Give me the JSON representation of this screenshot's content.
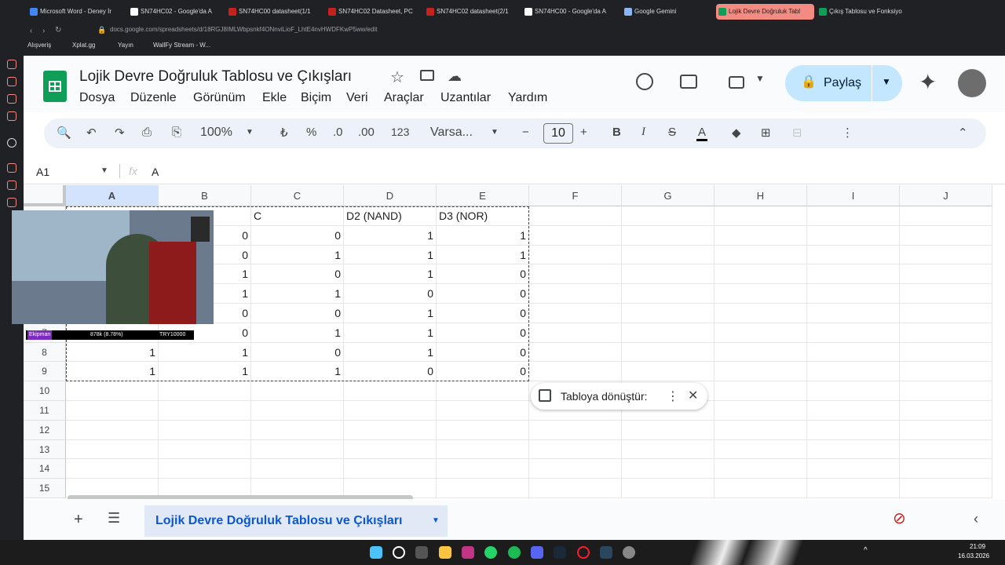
{
  "browser": {
    "tabs": [
      {
        "label": "Microsoft Word - Deney İr",
        "color": "#4285f4"
      },
      {
        "label": "SN74HC02 - Google'da A",
        "color": "#ffffff"
      },
      {
        "label": "SN74HC00 datasheet(1/1",
        "color": "#c5221f"
      },
      {
        "label": "SN74HC02 Datasheet, PC",
        "color": "#c5221f"
      },
      {
        "label": "SN74HC02 datasheet(2/1",
        "color": "#c5221f"
      },
      {
        "label": "SN74HC00 - Google'da A",
        "color": "#ffffff"
      },
      {
        "label": "Google Gemini",
        "color": "#8ab4f8"
      },
      {
        "label": "Lojik Devre Doğruluk Tabl",
        "color": "#0f9d58"
      },
      {
        "label": "Çıkış Tablosu ve Fonksiyo",
        "color": "#0f9d58"
      }
    ],
    "url": "docs.google.com/spreadsheets/d/18RGJ8IMLWbpsnkf4ONnviLioF_LhtE4nvHWDFKwP5ww/edit",
    "bookmarks": [
      "Alışveriş",
      "Xplat.gg",
      "Yayın",
      "WallFy Stream - W..."
    ]
  },
  "sheet": {
    "title": "Lojik Devre Doğruluk Tablosu ve Çıkışları",
    "menu": [
      "Dosya",
      "Düzenle",
      "Görünüm",
      "Ekle",
      "Biçim",
      "Veri",
      "Araçlar",
      "Uzantılar",
      "Yardım"
    ],
    "share_label": "Paylaş",
    "zoom": "100%",
    "currency": "₺",
    "percent": "%",
    "dec_less": ".0",
    "dec_more": ".00",
    "format_123": "123",
    "font": "Varsa...",
    "font_size": "10",
    "cell_ref": "A1",
    "formula": "A",
    "columns": [
      "A",
      "B",
      "C",
      "D",
      "E",
      "F",
      "G",
      "H",
      "I",
      "J"
    ],
    "rows": [
      "1",
      "2",
      "3",
      "4",
      "5",
      "6",
      "7",
      "8",
      "9",
      "10",
      "11",
      "12",
      "13",
      "14",
      "15"
    ],
    "header_row": {
      "C": "C",
      "D": "D2 (NAND)",
      "E": "D3 (NOR)"
    },
    "data": [
      [
        "",
        "0",
        "0",
        "1",
        "1"
      ],
      [
        "",
        "0",
        "1",
        "1",
        "1"
      ],
      [
        "",
        "1",
        "0",
        "1",
        "0"
      ],
      [
        "",
        "1",
        "1",
        "0",
        "0"
      ],
      [
        "",
        "0",
        "0",
        "1",
        "0"
      ],
      [
        "",
        "0",
        "1",
        "1",
        "0"
      ],
      [
        "1",
        "1",
        "0",
        "1",
        "0"
      ],
      [
        "1",
        "1",
        "1",
        "0",
        "0"
      ]
    ],
    "popup_label": "Tabloya dönüştür:",
    "sheet_tab": "Lojik Devre Doğruluk Tablosu ve Çıkışları"
  },
  "overlay": {
    "name": "Ekipman",
    "value": "878k (8.78%)",
    "price": "TRY10000"
  },
  "taskbar": {
    "time": "21:09",
    "date": "16.03.2026"
  }
}
